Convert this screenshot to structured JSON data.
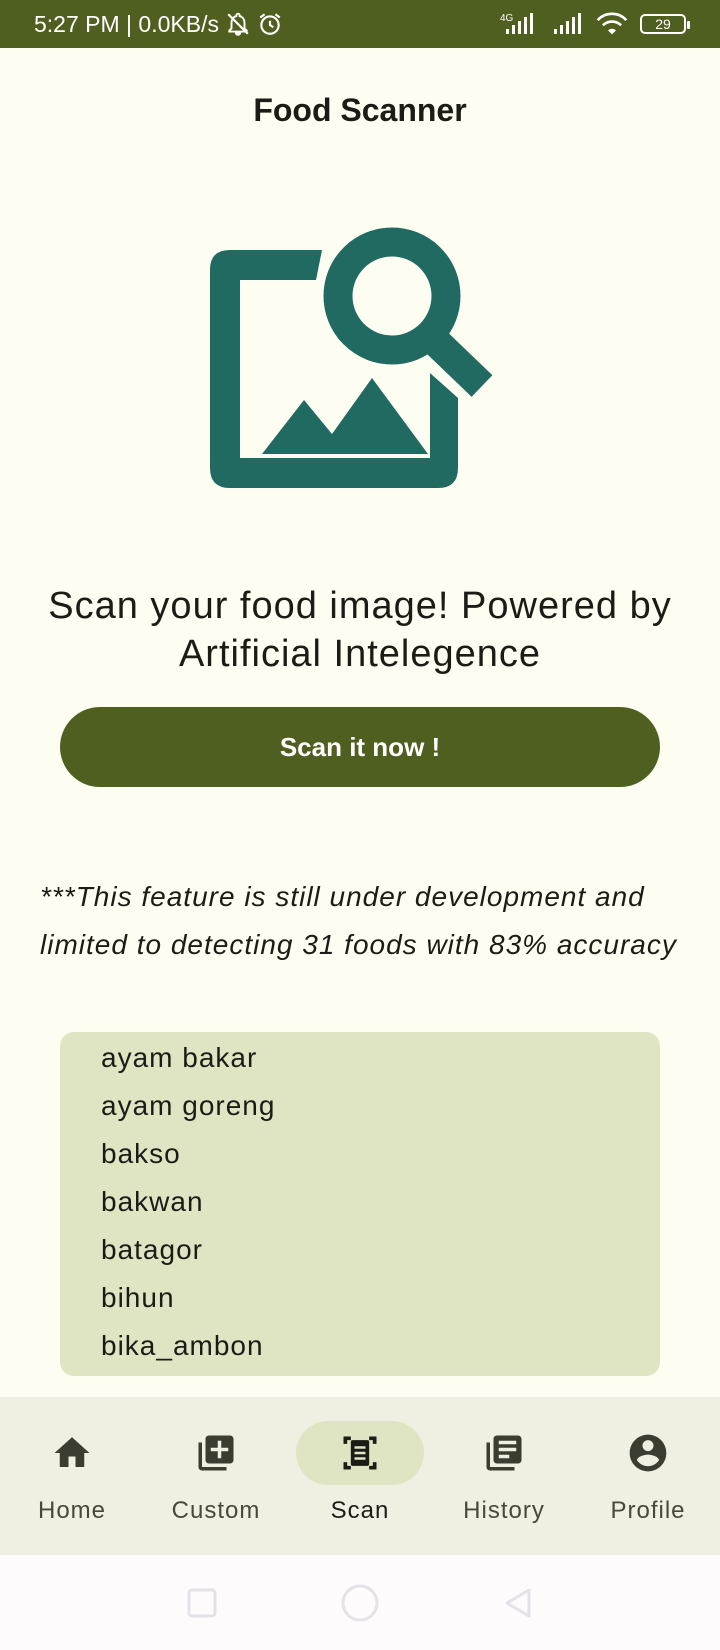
{
  "status": {
    "time_speed": "5:27 PM | 0.0KB/s",
    "network": "4G",
    "battery": "29"
  },
  "app": {
    "title": "Food Scanner"
  },
  "hero": {
    "icon": "image-search-icon",
    "color": "#216a62"
  },
  "tagline": "Scan your food image! Powered by Artificial Intelegence",
  "scan_button": {
    "label": "Scan it now !"
  },
  "disclaimer": "***This feature is still under development and limited to detecting 31 foods with 83% accuracy",
  "foods": [
    "ayam bakar",
    "ayam goreng",
    "bakso",
    "bakwan",
    "batagor",
    "bihun",
    "bika_ambon"
  ],
  "nav": [
    {
      "label": "Home",
      "icon": "home-icon"
    },
    {
      "label": "Custom",
      "icon": "add-box-icon"
    },
    {
      "label": "Scan",
      "icon": "document-scanner-icon",
      "active": true
    },
    {
      "label": "History",
      "icon": "library-books-icon"
    },
    {
      "label": "Profile",
      "icon": "account-circle-icon"
    }
  ],
  "colors": {
    "primary": "#4f5f1f",
    "accent": "#216a62",
    "background": "#fdfdf1",
    "list_bg": "#dfe5c3",
    "nav_bg": "#eff0e1"
  }
}
